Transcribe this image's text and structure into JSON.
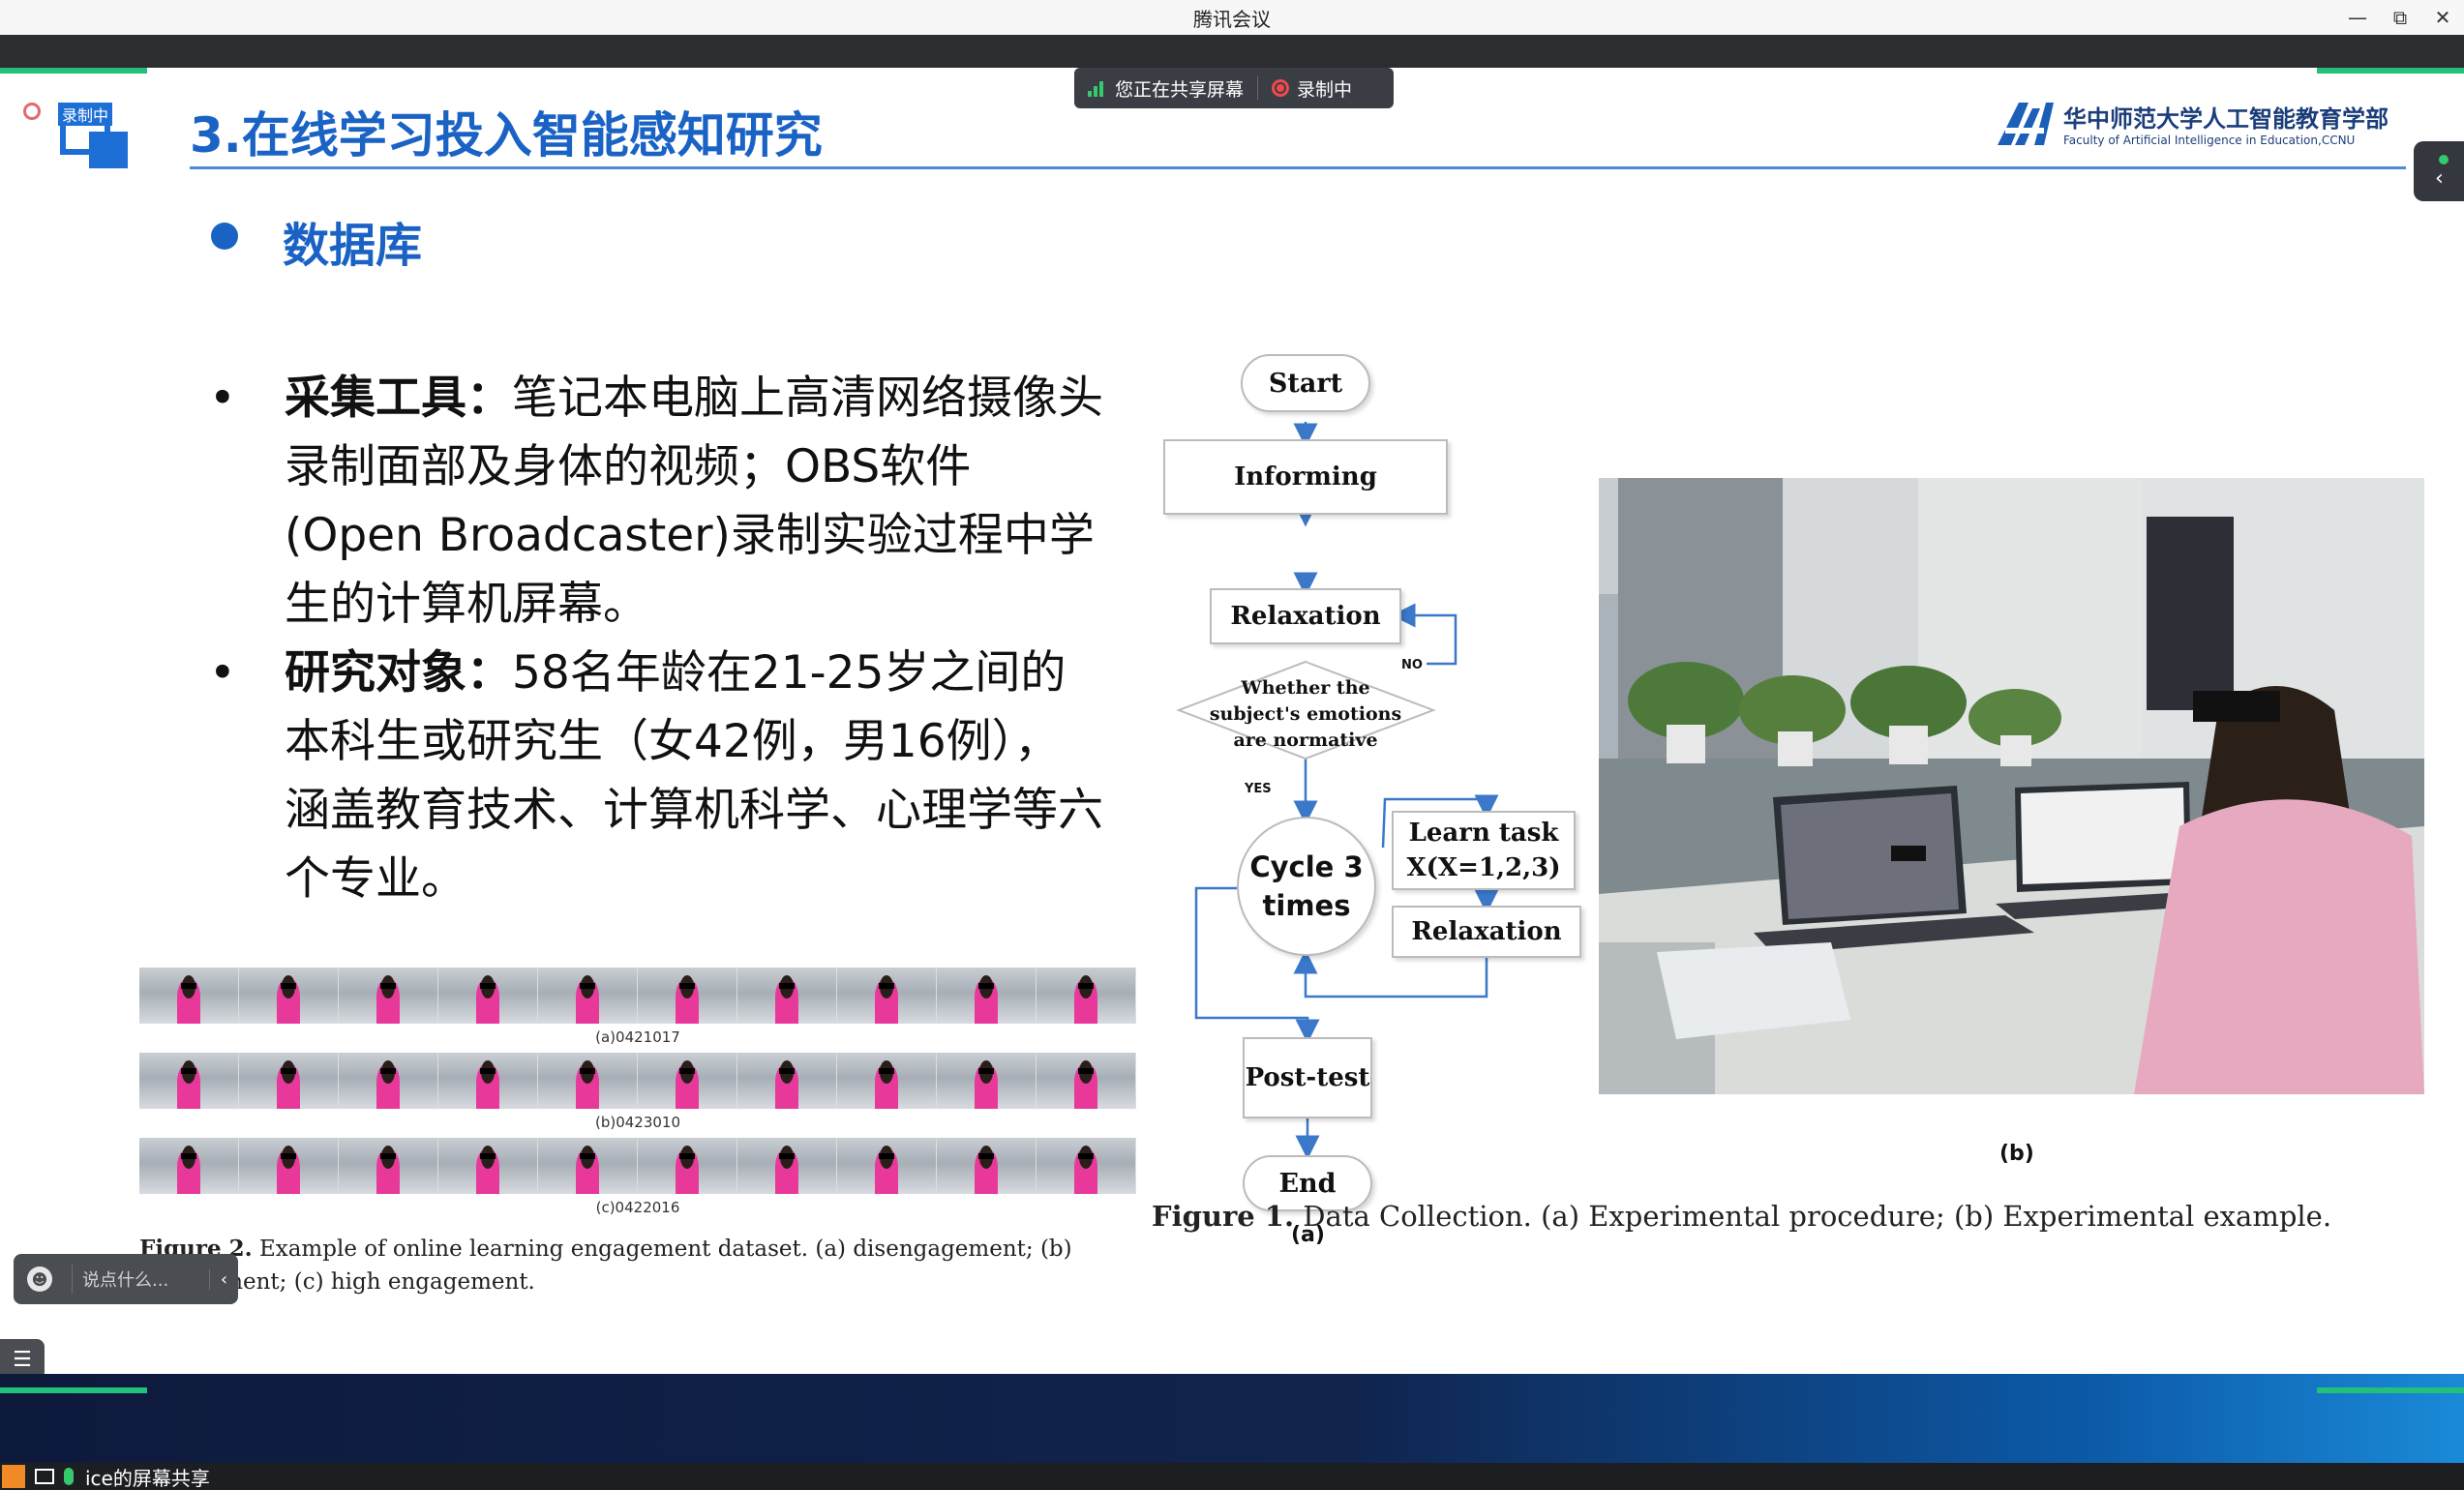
{
  "window": {
    "title": "腾讯会议",
    "controls": [
      "—",
      "⧉",
      "✕"
    ]
  },
  "share_bar": {
    "sharing_text": "您正在共享屏幕",
    "recording_text": "录制中"
  },
  "recording_tag": "录制中",
  "slide": {
    "title": "3.在线学习投入智能感知研究",
    "university": {
      "name_cn": "华中师范大学人工智能教育学部",
      "name_en": "Faculty of Artificial Intelligence in Education,CCNU"
    },
    "section_heading": "数据库",
    "bullets": [
      {
        "label": "采集工具：",
        "text": "笔记本电脑上高清网络摄像头录制面部及身体的视频；OBS软件(Open Broadcaster)录制实验过程中学生的计算机屏幕。"
      },
      {
        "label": "研究对象：",
        "text": "58名年龄在21-25岁之间的本科生或研究生（女42例，男16例），涵盖教育技术、计算机科学、心理学等六个专业。"
      }
    ],
    "figure2": {
      "strip_captions": [
        "(a)0421017",
        "(b)0423010",
        "(c)0422016"
      ],
      "caption_label": "Figure 2.",
      "caption_text": "Example of online learning engagement dataset.  (a) disengagement; (b) engagement; (c) high engagement."
    },
    "flowchart": {
      "start": "Start",
      "informing": "Informing",
      "relaxation": "Relaxation",
      "decision_lines": [
        "Whether the",
        "subject's emotions",
        "are normative"
      ],
      "no_label": "NO",
      "yes_label": "YES",
      "cycle_lines": [
        "Cycle 3",
        "times"
      ],
      "learn_task_lines": [
        "Learn task",
        "X(X=1,2,3)"
      ],
      "relaxation2": "Relaxation",
      "post_test": "Post-test",
      "end": "End",
      "panel_label": "(a)"
    },
    "photo_panel_label": "(b)",
    "figure1": {
      "caption_label": "Figure 1.",
      "caption_text": "Data Collection. (a) Experimental procedure; (b) Experimental example."
    }
  },
  "chat": {
    "placeholder": "说点什么...",
    "expand_icon": "‹"
  },
  "taskbar": {
    "label": "ice的屏幕共享"
  },
  "colors": {
    "accent_blue": "#1a63c5",
    "accent_green": "#22c07a",
    "record_red": "#f04a4a"
  }
}
